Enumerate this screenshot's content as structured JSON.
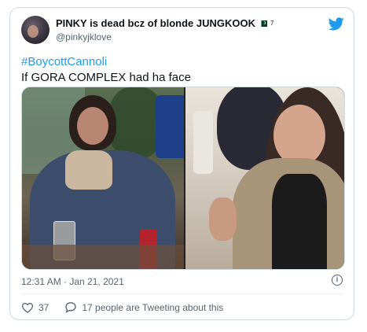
{
  "tweet": {
    "display_name": "PINKY is dead bcz of blonde JUNGKOOK",
    "name_suffix": "7",
    "handle": "@pinkyjklove",
    "hashtag": "#BoycottCannoli",
    "text": "If GORA COMPLEX had ha face",
    "timestamp": "12:31 AM · Jan 21, 2021",
    "likes": "37",
    "talking": "17 people are Tweeting about this"
  },
  "colors": {
    "link": "#1d9bf0",
    "muted": "#536471",
    "heart": "#536471",
    "brand": "#1d9bf0"
  },
  "icons": {
    "logo": "twitter-bird-icon",
    "info": "info-icon",
    "like": "heart-icon",
    "reply": "speech-bubble-icon",
    "flag": "pakistan-flag-icon"
  }
}
